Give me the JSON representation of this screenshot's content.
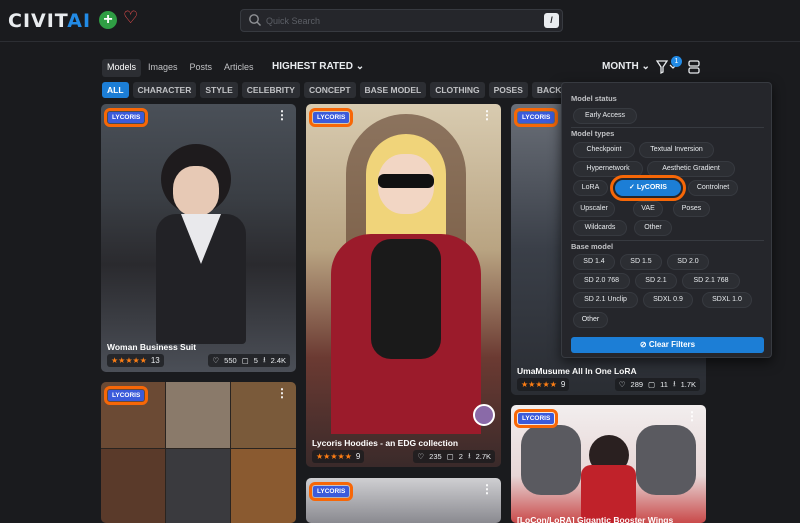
{
  "header": {
    "logo_main": "CIVIT",
    "logo_accent": "AI",
    "search_placeholder": "Quick Search",
    "search_shortcut": "/"
  },
  "nav": {
    "tabs": [
      {
        "label": "Models",
        "active": true
      },
      {
        "label": "Images",
        "active": false
      },
      {
        "label": "Posts",
        "active": false
      },
      {
        "label": "Articles",
        "active": false
      }
    ],
    "sort": "HIGHEST RATED",
    "period": "MONTH",
    "filter_count": "1"
  },
  "chips": [
    "ALL",
    "CHARACTER",
    "STYLE",
    "CELEBRITY",
    "CONCEPT",
    "BASE MODEL",
    "CLOTHING",
    "POSES",
    "BACKGROUND"
  ],
  "cards": [
    {
      "badge": "LYCORIS",
      "title": "Woman Business Suit",
      "rating": "13",
      "likes": "550",
      "comments": "5",
      "downloads": "2.4K"
    },
    {
      "badge": "LYCORIS",
      "title": "Lycoris Hoodies - an EDG collection",
      "rating": "9",
      "likes": "235",
      "comments": "2",
      "downloads": "2.7K"
    },
    {
      "badge": "LYCORIS",
      "title": "UmaMusume All In One LoRA",
      "rating": "9",
      "likes": "289",
      "comments": "11",
      "downloads": "1.7K"
    },
    {
      "badge": "LYCORIS",
      "title": ""
    },
    {
      "badge": "LYCORIS",
      "title": "[LoCon/LoRA] Gigantic Booster Wings Concept"
    },
    {
      "badge": "LYCORIS",
      "title": ""
    }
  ],
  "filters": {
    "status_label": "Model status",
    "status_options": [
      "Early Access"
    ],
    "types_label": "Model types",
    "type_options": [
      "Checkpoint",
      "Textual Inversion",
      "Hypernetwork",
      "Aesthetic Gradient",
      "LoRA",
      "LyCORIS",
      "Controlnet",
      "Upscaler",
      "VAE",
      "Poses",
      "Wildcards",
      "Other"
    ],
    "selected_type": "LyCORIS",
    "base_label": "Base model",
    "base_options": [
      "SD 1.4",
      "SD 1.5",
      "SD 2.0",
      "SD 2.0 768",
      "SD 2.1",
      "SD 2.1 768",
      "SD 2.1 Unclip",
      "SDXL 0.9",
      "SDXL 1.0",
      "Other"
    ],
    "clear_label": "Clear Filters"
  },
  "colors": {
    "accent": "#1c7ed6",
    "highlight": "#f76707",
    "background": "#1a1b1e"
  }
}
